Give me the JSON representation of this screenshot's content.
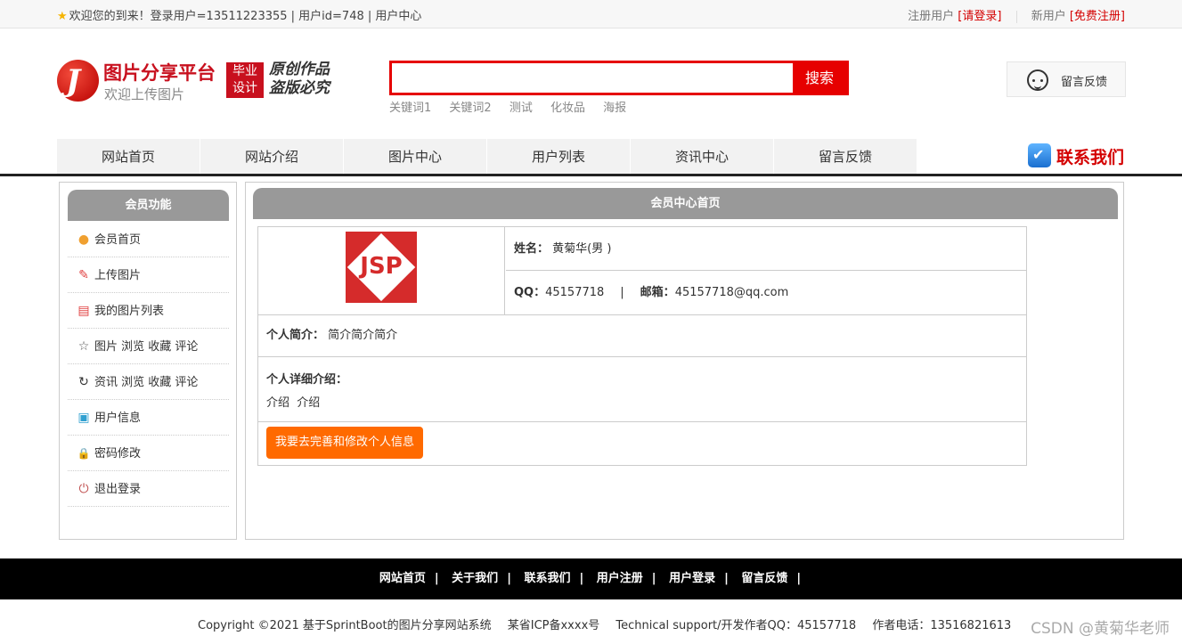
{
  "topbar": {
    "welcome": "欢迎您的到来！登录用户=13511223355 | 用户id=748 | 用户中心",
    "registered_label": "注册用户",
    "login_link": "[请登录]",
    "new_user_label": "新用户",
    "register_link": "[免费注册]"
  },
  "header": {
    "logo_title": "图片分享平台",
    "logo_subtitle": "欢迎上传图片",
    "badge_line1": "毕业",
    "badge_line2": "设计",
    "slogan_line1": "原创作品",
    "slogan_line2": "盗版必究",
    "search_button": "搜索",
    "keywords": [
      "关键词1",
      "关键词2",
      "测试",
      "化妆品",
      "海报"
    ],
    "feedback": "留言反馈"
  },
  "nav": {
    "items": [
      "网站首页",
      "网站介绍",
      "图片中心",
      "用户列表",
      "资讯中心",
      "留言反馈"
    ],
    "contact": "联系我们"
  },
  "sidebar": {
    "title": "会员功能",
    "items": [
      {
        "label": "会员首页",
        "icon": "home-icon",
        "glyph": "●",
        "color": "#f0a030"
      },
      {
        "label": "上传图片",
        "icon": "edit-icon",
        "glyph": "✎",
        "color": "#e04040"
      },
      {
        "label": "我的图片列表",
        "icon": "list-icon",
        "glyph": "▤",
        "color": "#e04040"
      },
      {
        "label": "图片 浏览 收藏 评论",
        "icon": "star-icon",
        "glyph": "☆",
        "color": "#555555"
      },
      {
        "label": "资讯 浏览 收藏 评论",
        "icon": "history-icon",
        "glyph": "↻",
        "color": "#333333"
      },
      {
        "label": "用户信息",
        "icon": "clipboard-icon",
        "glyph": "▣",
        "color": "#30a0d0"
      },
      {
        "label": "密码修改",
        "icon": "lock-icon",
        "glyph": "🔒",
        "color": "#e08030"
      },
      {
        "label": "退出登录",
        "icon": "power-icon",
        "glyph": "⏻",
        "color": "#c05050"
      }
    ]
  },
  "main": {
    "title": "会员中心首页",
    "avatar_text": "JSP",
    "name_label": "姓名：",
    "name_value": "黄菊华(男 )",
    "qq_label": "QQ：",
    "qq_value": "45157718",
    "pipe": "|",
    "email_label": "邮箱：",
    "email_value": "45157718@qq.com",
    "intro_label": "个人简介：",
    "intro_value": "简介简介简介",
    "detail_label": "个人详细介绍：",
    "detail_value": "介绍  介绍",
    "edit_button": "我要去完善和修改个人信息"
  },
  "footer": {
    "links": [
      "网站首页",
      "关于我们",
      "联系我们",
      "用户注册",
      "用户登录",
      "留言反馈"
    ],
    "separator": "|",
    "copyright": "Copyright ©2021 基于SprintBoot的图片分享网站系统",
    "icp": "某省ICP备xxxx号",
    "support": "Technical support/开发作者QQ：45157718",
    "phone": "作者电话：13516821613",
    "watermark": "CSDN @黄菊华老师"
  },
  "colors": {
    "brand_red": "#e60000",
    "header_gray": "#999999",
    "button_orange": "#ff6a00"
  }
}
